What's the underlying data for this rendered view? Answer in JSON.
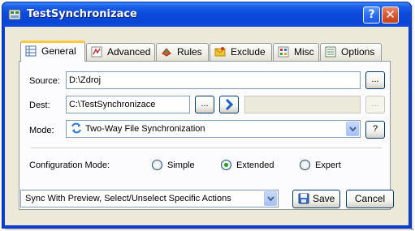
{
  "window": {
    "title": "TestSynchronizace"
  },
  "tabs": [
    {
      "label": "General",
      "icon": "general-grid-icon",
      "active": true
    },
    {
      "label": "Advanced",
      "icon": "advanced-icon",
      "active": false
    },
    {
      "label": "Rules",
      "icon": "rules-icon",
      "active": false
    },
    {
      "label": "Exclude",
      "icon": "exclude-icon",
      "active": false
    },
    {
      "label": "Misc",
      "icon": "misc-icon",
      "active": false
    },
    {
      "label": "Options",
      "icon": "options-icon",
      "active": false
    }
  ],
  "general": {
    "source_label": "Source:",
    "source_value": "D:\\Zdroj",
    "dest_label": "Dest:",
    "dest_value": "C:\\TestSynchronizace",
    "dest_secondary_value": "",
    "browse_label": "...",
    "mode_label": "Mode:",
    "mode_value": "Two-Way File Synchronization",
    "mode_help": "?",
    "config_mode_label": "Configuration Mode:",
    "config_modes": [
      {
        "label": "Simple",
        "checked": false
      },
      {
        "label": "Extended",
        "checked": true
      },
      {
        "label": "Expert",
        "checked": false
      }
    ]
  },
  "footer": {
    "run_mode_value": "Sync With Preview, Select/Unselect Specific Actions",
    "save_label": "Save",
    "cancel_label": "Cancel"
  },
  "colors": {
    "titlebar": "#0a46d6",
    "dialog_face": "#ece9d8",
    "tab_highlight": "#ffc83c",
    "close_button": "#d85a31"
  }
}
